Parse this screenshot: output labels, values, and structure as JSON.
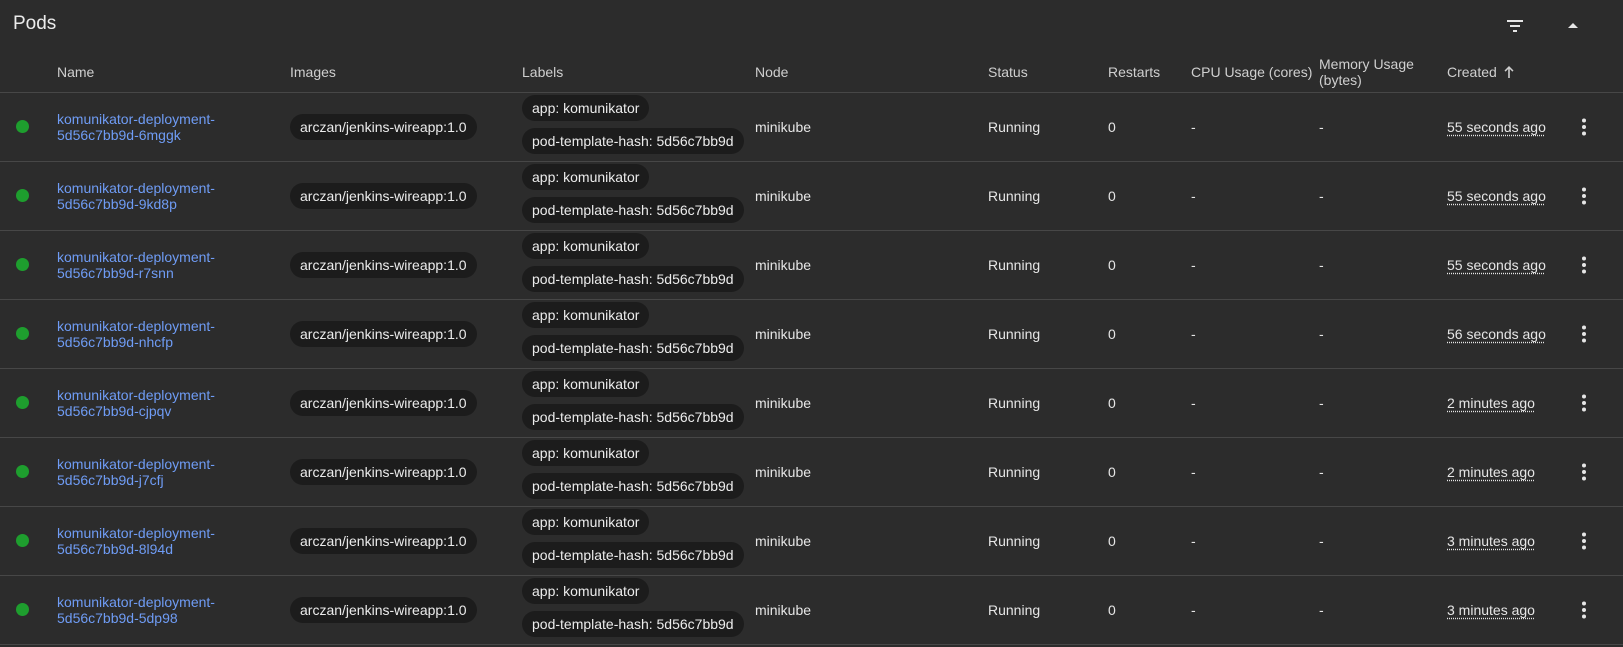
{
  "panel": {
    "title": "Pods",
    "filter_icon": "filter-icon",
    "collapse_icon": "collapse-up-icon"
  },
  "columns": {
    "name": "Name",
    "images": "Images",
    "labels": "Labels",
    "node": "Node",
    "status": "Status",
    "restarts": "Restarts",
    "cpu": "CPU Usage (cores)",
    "memory_line1": "Memory Usage",
    "memory_line2": "(bytes)",
    "created": "Created"
  },
  "rows": [
    {
      "name": "komunikator-deployment-5d56c7bb9d-6mggk",
      "image": "arczan/jenkins-wireapp:1.0",
      "label1": "app: komunikator",
      "label2": "pod-template-hash: 5d56c7bb9d",
      "node": "minikube",
      "status": "Running",
      "restarts": "0",
      "cpu": "-",
      "memory": "-",
      "created": "55 seconds ago"
    },
    {
      "name": "komunikator-deployment-5d56c7bb9d-9kd8p",
      "image": "arczan/jenkins-wireapp:1.0",
      "label1": "app: komunikator",
      "label2": "pod-template-hash: 5d56c7bb9d",
      "node": "minikube",
      "status": "Running",
      "restarts": "0",
      "cpu": "-",
      "memory": "-",
      "created": "55 seconds ago"
    },
    {
      "name": "komunikator-deployment-5d56c7bb9d-r7snn",
      "image": "arczan/jenkins-wireapp:1.0",
      "label1": "app: komunikator",
      "label2": "pod-template-hash: 5d56c7bb9d",
      "node": "minikube",
      "status": "Running",
      "restarts": "0",
      "cpu": "-",
      "memory": "-",
      "created": "55 seconds ago"
    },
    {
      "name": "komunikator-deployment-5d56c7bb9d-nhcfp",
      "image": "arczan/jenkins-wireapp:1.0",
      "label1": "app: komunikator",
      "label2": "pod-template-hash: 5d56c7bb9d",
      "node": "minikube",
      "status": "Running",
      "restarts": "0",
      "cpu": "-",
      "memory": "-",
      "created": "56 seconds ago"
    },
    {
      "name": "komunikator-deployment-5d56c7bb9d-cjpqv",
      "image": "arczan/jenkins-wireapp:1.0",
      "label1": "app: komunikator",
      "label2": "pod-template-hash: 5d56c7bb9d",
      "node": "minikube",
      "status": "Running",
      "restarts": "0",
      "cpu": "-",
      "memory": "-",
      "created": "2 minutes ago"
    },
    {
      "name": "komunikator-deployment-5d56c7bb9d-j7cfj",
      "image": "arczan/jenkins-wireapp:1.0",
      "label1": "app: komunikator",
      "label2": "pod-template-hash: 5d56c7bb9d",
      "node": "minikube",
      "status": "Running",
      "restarts": "0",
      "cpu": "-",
      "memory": "-",
      "created": "2 minutes ago"
    },
    {
      "name": "komunikator-deployment-5d56c7bb9d-8l94d",
      "image": "arczan/jenkins-wireapp:1.0",
      "label1": "app: komunikator",
      "label2": "pod-template-hash: 5d56c7bb9d",
      "node": "minikube",
      "status": "Running",
      "restarts": "0",
      "cpu": "-",
      "memory": "-",
      "created": "3 minutes ago"
    },
    {
      "name": "komunikator-deployment-5d56c7bb9d-5dp98",
      "image": "arczan/jenkins-wireapp:1.0",
      "label1": "app: komunikator",
      "label2": "pod-template-hash: 5d56c7bb9d",
      "node": "minikube",
      "status": "Running",
      "restarts": "0",
      "cpu": "-",
      "memory": "-",
      "created": "3 minutes ago"
    }
  ],
  "colors": {
    "background": "#2c2c2c",
    "link": "#6f9cf5",
    "status_running": "#1e9e2e",
    "chip": "#1c1c1c",
    "divider": "#474747"
  }
}
